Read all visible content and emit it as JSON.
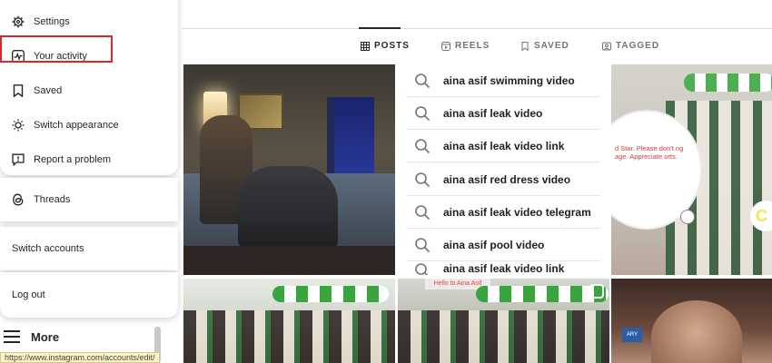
{
  "menu": {
    "items": [
      {
        "label": "Settings",
        "icon": "gear-icon"
      },
      {
        "label": "Your activity",
        "icon": "activity-icon"
      },
      {
        "label": "Saved",
        "icon": "bookmark-icon"
      },
      {
        "label": "Switch appearance",
        "icon": "sun-icon"
      },
      {
        "label": "Report a problem",
        "icon": "report-icon"
      }
    ],
    "threads_label": "Threads",
    "switch_accounts_label": "Switch accounts",
    "logout_label": "Log out",
    "highlight_color": "#d42a2a"
  },
  "sidebar": {
    "more_label": "More"
  },
  "status_bar": {
    "url": "https://www.instagram.com/accounts/edit/"
  },
  "profile_tabs": [
    {
      "label": "POSTS",
      "icon": "grid-icon",
      "active": true
    },
    {
      "label": "REELS",
      "icon": "reels-icon",
      "active": false
    },
    {
      "label": "SAVED",
      "icon": "bookmark-icon",
      "active": false
    },
    {
      "label": "TAGGED",
      "icon": "tag-icon",
      "active": false
    }
  ],
  "search_suggestions": [
    "aina asif swimming video",
    "aina asif leak video",
    "aina asif leak video link",
    "aina asif red dress video",
    "aina asif leak video telegram",
    "aina asif pool video",
    "aina asif leak video link"
  ],
  "tiles": {
    "cloud_text": "d Star. Please don't ng age. Appreciate orts.",
    "sign_text": "Hello to Aina Asif",
    "logo_text": "ARY"
  }
}
